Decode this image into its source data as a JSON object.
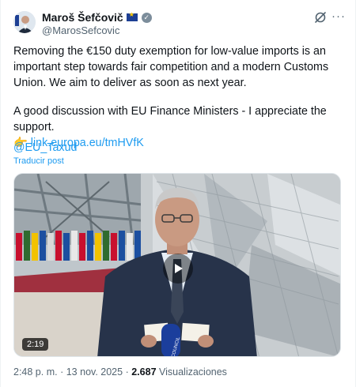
{
  "author": {
    "name": "Maroš Šefčovič",
    "handle": "@MarosSefcovic"
  },
  "tweet": {
    "paragraph1": "Removing the €150 duty exemption for low-value imports is an important step towards fair competition and a modern Customs Union. We aim to deliver as soon as next year.",
    "paragraph2": "A good discussion with EU Finance Ministers - I appreciate the support.",
    "link_emoji": "👉",
    "link": "link.europa.eu/tmHVfK",
    "mention": "@EU_Taxud",
    "translate_label": "Traducir post"
  },
  "media": {
    "duration": "2:19",
    "podium_text": "COUNCIL"
  },
  "meta": {
    "time": "2:48 p. m.",
    "separator": "·",
    "date": "13 nov. 2025",
    "views_count": "2.687",
    "views_label": "Visualizaciones"
  },
  "icons": {
    "verified": "verified-badge-icon",
    "grok": "grok-icon",
    "more": "more-options-icon",
    "play": "play-icon",
    "flag": "eu-flag-icon"
  },
  "colors": {
    "accent": "#1d9bf0",
    "text": "#0f1419",
    "secondary": "#536471"
  }
}
